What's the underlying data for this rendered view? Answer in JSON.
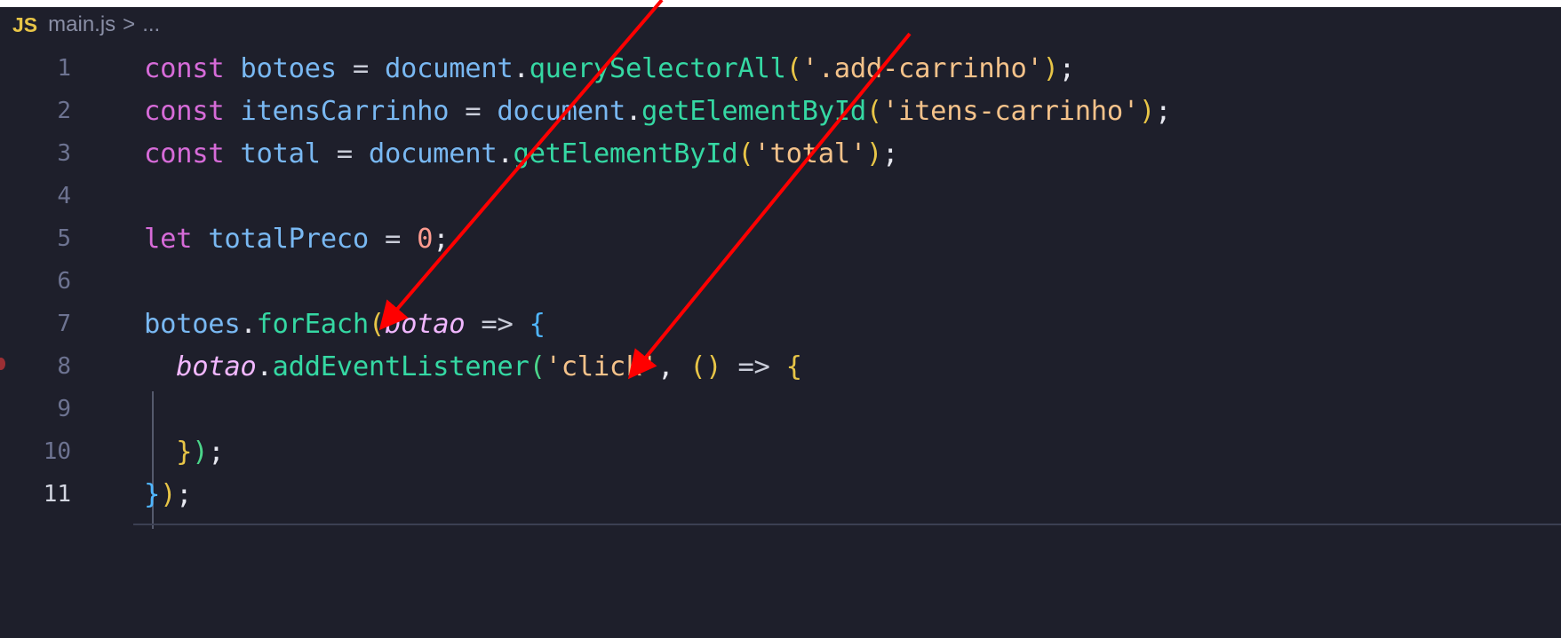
{
  "breadcrumb": {
    "file_icon": "JS",
    "file_name": "main.js",
    "separator": ">",
    "ellipsis": "..."
  },
  "editor": {
    "lines": [
      {
        "number": "1",
        "tokens": [
          [
            "kw",
            "const "
          ],
          [
            "id",
            "botoes"
          ],
          [
            "op",
            " = "
          ],
          [
            "id",
            "document"
          ],
          [
            "plain",
            "."
          ],
          [
            "fn",
            "querySelectorAll"
          ],
          [
            "bracket-y",
            "("
          ],
          [
            "str",
            "'.add-carrinho'"
          ],
          [
            "bracket-y",
            ")"
          ],
          [
            "plain",
            ";"
          ]
        ]
      },
      {
        "number": "2",
        "tokens": [
          [
            "kw",
            "const "
          ],
          [
            "id",
            "itensCarrinho"
          ],
          [
            "op",
            " = "
          ],
          [
            "id",
            "document"
          ],
          [
            "plain",
            "."
          ],
          [
            "fn",
            "getElementById"
          ],
          [
            "bracket-y",
            "("
          ],
          [
            "str",
            "'itens-carrinho'"
          ],
          [
            "bracket-y",
            ")"
          ],
          [
            "plain",
            ";"
          ]
        ]
      },
      {
        "number": "3",
        "tokens": [
          [
            "kw",
            "const "
          ],
          [
            "id",
            "total"
          ],
          [
            "op",
            " = "
          ],
          [
            "id",
            "document"
          ],
          [
            "plain",
            "."
          ],
          [
            "fn",
            "getElementById"
          ],
          [
            "bracket-y",
            "("
          ],
          [
            "str",
            "'total'"
          ],
          [
            "bracket-y",
            ")"
          ],
          [
            "plain",
            ";"
          ]
        ]
      },
      {
        "number": "4",
        "tokens": []
      },
      {
        "number": "5",
        "tokens": [
          [
            "kw",
            "let "
          ],
          [
            "id",
            "totalPreco"
          ],
          [
            "op",
            " = "
          ],
          [
            "num",
            "0"
          ],
          [
            "plain",
            ";"
          ]
        ]
      },
      {
        "number": "6",
        "tokens": []
      },
      {
        "number": "7",
        "tokens": [
          [
            "id",
            "botoes"
          ],
          [
            "plain",
            "."
          ],
          [
            "fn",
            "forEach"
          ],
          [
            "bracket-y",
            "("
          ],
          [
            "param",
            "botao"
          ],
          [
            "op",
            " => "
          ],
          [
            "bracket-b",
            "{"
          ]
        ]
      },
      {
        "number": "8",
        "tokens": [
          [
            "plain",
            "  "
          ],
          [
            "param",
            "botao"
          ],
          [
            "plain",
            "."
          ],
          [
            "fn",
            "addEventListener"
          ],
          [
            "bracket-g",
            "("
          ],
          [
            "str",
            "'click'"
          ],
          [
            "plain",
            ", "
          ],
          [
            "bracket-y",
            "()"
          ],
          [
            "op",
            " => "
          ],
          [
            "bracket-y",
            "{"
          ]
        ]
      },
      {
        "number": "9",
        "tokens": []
      },
      {
        "number": "10",
        "tokens": [
          [
            "plain",
            "  "
          ],
          [
            "bracket-y",
            "}"
          ],
          [
            "bracket-g",
            ")"
          ],
          [
            "plain",
            ";"
          ]
        ]
      },
      {
        "number": "11",
        "tokens": [
          [
            "bracket-b",
            "}"
          ],
          [
            "bracket-y",
            ")"
          ],
          [
            "plain",
            ";"
          ]
        ]
      }
    ],
    "active_line": "11"
  },
  "colors": {
    "background": "#1e1f2b",
    "annotation_arrow": "#ff0000"
  }
}
